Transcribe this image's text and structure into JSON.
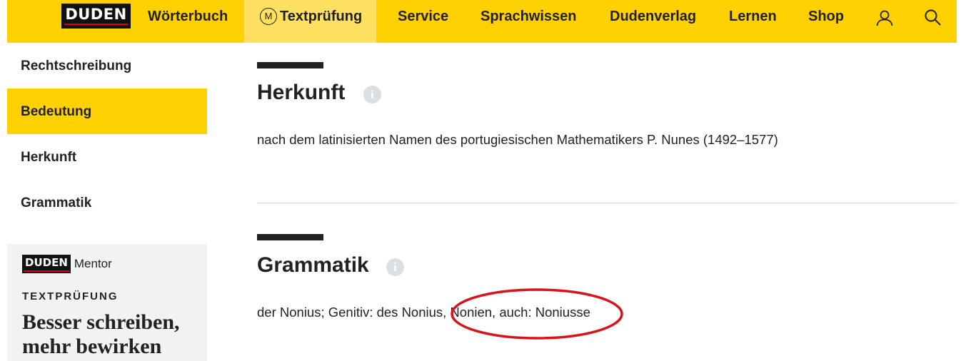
{
  "nav": {
    "logo": "DUDEN",
    "items": [
      "Wörterbuch",
      "Textprüfung",
      "Service",
      "Sprachwissen",
      "Dudenverlag",
      "Lernen",
      "Shop"
    ],
    "mentor_badge": "M",
    "icons": [
      "user-icon",
      "search-icon"
    ]
  },
  "sidebar": {
    "items": [
      "Rechtschreibung",
      "Bedeutung",
      "Herkunft",
      "Grammatik"
    ]
  },
  "mentor": {
    "logo": "DUDEN",
    "brand": "Mentor",
    "tag": "TEXTPRÜFUNG",
    "headline_1": "Besser schreiben,",
    "headline_2": "mehr bewirken"
  },
  "sections": [
    {
      "title": "Herkunft",
      "info": "i",
      "text": "nach dem latinisierten Namen des portugiesischen Mathematikers P. Nunes (1492–1577)"
    },
    {
      "title": "Grammatik",
      "info": "i",
      "text": "der Nonius; Genitiv: des Nonius, Nonien, auch: Noniusse"
    }
  ],
  "colors": {
    "brand_yellow": "#ffd100",
    "active_nav": "#ffe060",
    "annotation_red": "#d7141a",
    "dark": "#222222"
  }
}
